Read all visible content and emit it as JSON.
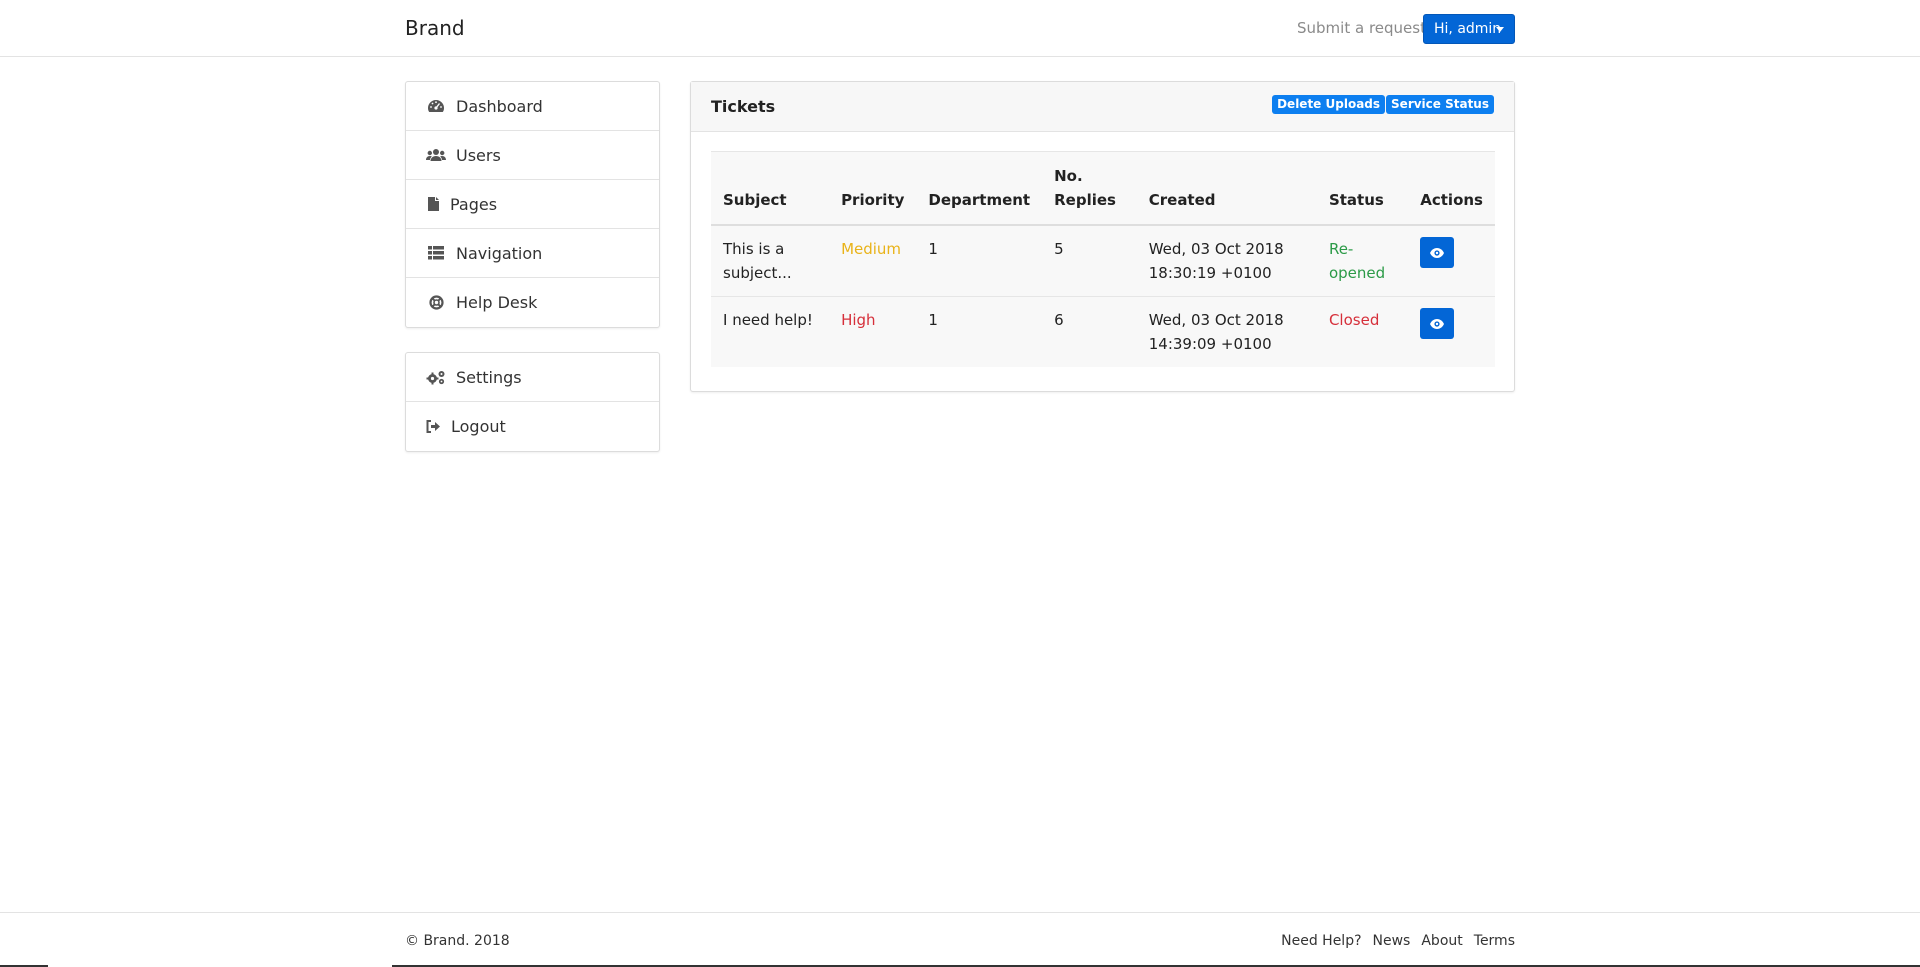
{
  "navbar": {
    "brand": "Brand",
    "submit_link": "Submit a request?",
    "user_button": "Hi, admin"
  },
  "sidebar": {
    "main_items": [
      {
        "label": "Dashboard",
        "icon": "dashboard-icon"
      },
      {
        "label": "Users",
        "icon": "users-icon"
      },
      {
        "label": "Pages",
        "icon": "file-icon"
      },
      {
        "label": "Navigation",
        "icon": "list-icon"
      },
      {
        "label": "Help Desk",
        "icon": "life-ring-icon"
      }
    ],
    "secondary_items": [
      {
        "label": "Settings",
        "icon": "cogs-icon"
      },
      {
        "label": "Logout",
        "icon": "sign-out-icon"
      }
    ]
  },
  "tickets": {
    "title": "Tickets",
    "buttons": {
      "delete_uploads": "Delete Uploads",
      "service_status": "Service Status"
    },
    "columns": {
      "subject": "Subject",
      "priority": "Priority",
      "department": "Department",
      "replies_1": "No.",
      "replies_2": "Replies",
      "created": "Created",
      "status": "Status",
      "actions": "Actions"
    },
    "rows": [
      {
        "subject_1": "This is a",
        "subject_2": "subject...",
        "priority": "Medium",
        "department": "1",
        "replies": "5",
        "created_1": "Wed, 03 Oct 2018",
        "created_2": "18:30:19 +0100",
        "status_1": "Re-",
        "status_2": "opened"
      },
      {
        "subject_1": "I need help!",
        "subject_2": "",
        "priority": "High",
        "department": "1",
        "replies": "6",
        "created_1": "Wed, 03 Oct 2018",
        "created_2": "14:39:09 +0100",
        "status_1": "Closed",
        "status_2": ""
      }
    ]
  },
  "footer": {
    "copyright": "© Brand. 2018",
    "links": [
      "Need Help?",
      "News",
      "About",
      "Terms"
    ]
  },
  "colors": {
    "primary": "#0366d6",
    "badge": "#0d7ff0",
    "medium": "#e9b319",
    "high": "#d62f3a",
    "reopened": "#2b9a47",
    "closed": "#d62f3a"
  }
}
